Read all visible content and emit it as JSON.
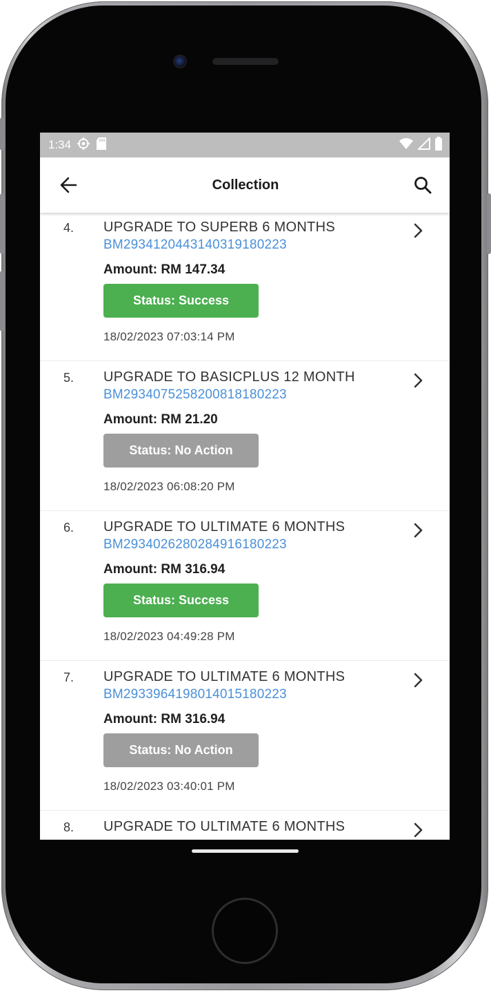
{
  "status_bar": {
    "time": "1:34",
    "icons": [
      "settings-icon",
      "sd-card-icon",
      "wifi-icon",
      "signal-icon",
      "battery-icon"
    ]
  },
  "app_bar": {
    "title": "Collection",
    "back_icon": "arrow-left-icon",
    "search_icon": "search-icon"
  },
  "colors": {
    "success": "#4caf50",
    "no_action": "#9e9e9e",
    "reference_link": "#4a90d9",
    "status_bar": "#bdbdbd"
  },
  "items": [
    {
      "number": "4.",
      "title": "UPGRADE TO SUPERB 6 MONTHS",
      "reference": "BM29341204431403191802​23",
      "amount": "Amount: RM 147.34",
      "status": "Status: Success",
      "status_type": "success",
      "date": "18/02/2023 07:03:14 PM"
    },
    {
      "number": "5.",
      "title": "UPGRADE TO BASICPLUS 12 MONTH",
      "reference": "BM293407525820081818​0223",
      "amount": "Amount: RM 21.20",
      "status": "Status: No Action",
      "status_type": "no_action",
      "date": "18/02/2023 06:08:20 PM"
    },
    {
      "number": "6.",
      "title": "UPGRADE TO ULTIMATE 6 MONTHS",
      "reference": "BM29340262802849161​80223",
      "amount": "Amount: RM 316.94",
      "status": "Status: Success",
      "status_type": "success",
      "date": "18/02/2023 04:49:28 PM"
    },
    {
      "number": "7.",
      "title": "UPGRADE TO ULTIMATE 6 MONTHS",
      "reference": "BM29339641980140151​80223",
      "amount": "Amount: RM 316.94",
      "status": "Status: No Action",
      "status_type": "no_action",
      "date": "18/02/2023 03:40:01 PM"
    },
    {
      "number": "8.",
      "title": "UPGRADE TO ULTIMATE 6 MONTHS"
    }
  ]
}
